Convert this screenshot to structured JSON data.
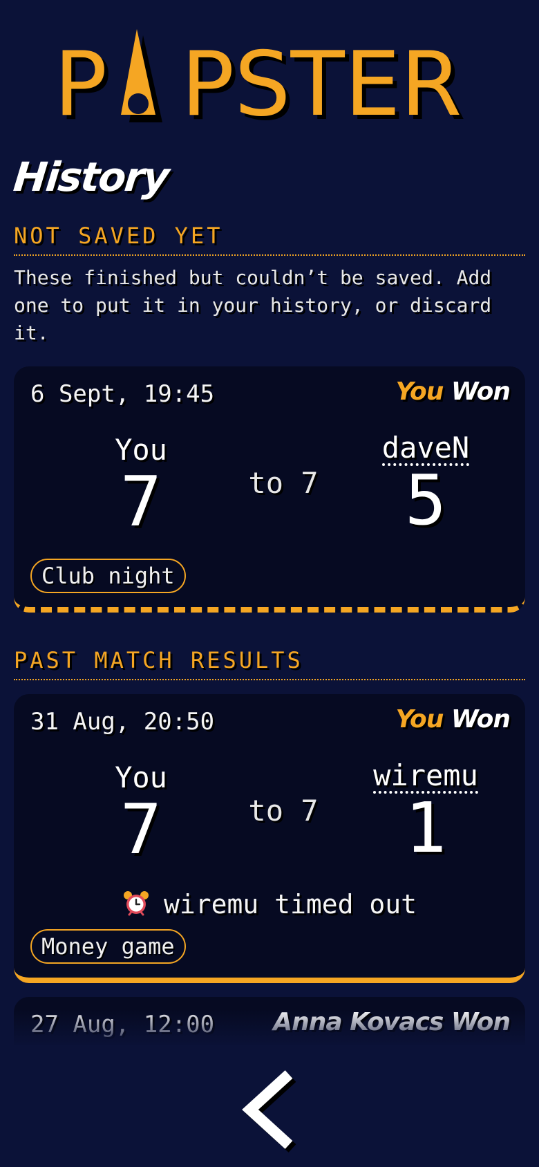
{
  "app": {
    "logo_text": "PAPSTER",
    "logo_text_left": "P",
    "logo_text_right": "PSTER",
    "page_title": "History"
  },
  "colors": {
    "background": "#0b1238",
    "card": "#060a22",
    "accent": "#f5a623",
    "text": "#ffffff"
  },
  "unsaved": {
    "heading": "NOT SAVED YET",
    "intro": "These finished but couldn’t be saved. Add one to put it in your history, or discard it.",
    "matches": [
      {
        "date": "6 Sept, 19:45",
        "result_you": "You",
        "result_won": "Won",
        "player": "You",
        "player_score": "7",
        "target": "to 7",
        "opponent": "daveN",
        "opponent_score": "5",
        "tag": "Club night"
      }
    ]
  },
  "past": {
    "heading": "PAST MATCH RESULTS",
    "matches": [
      {
        "date": "31 Aug, 20:50",
        "result_you": "You",
        "result_won": "Won",
        "player": "You",
        "player_score": "7",
        "target": "to 7",
        "opponent": "wiremu",
        "opponent_score": "1",
        "note": "wiremu timed out",
        "note_icon": "alarm-clock-icon",
        "tag": "Money game"
      },
      {
        "date": "27 Aug, 12:00",
        "result_name": "Anna Kovacs",
        "result_won": "Won"
      }
    ]
  },
  "navigation": {
    "back_icon": "chevron-left-icon"
  }
}
